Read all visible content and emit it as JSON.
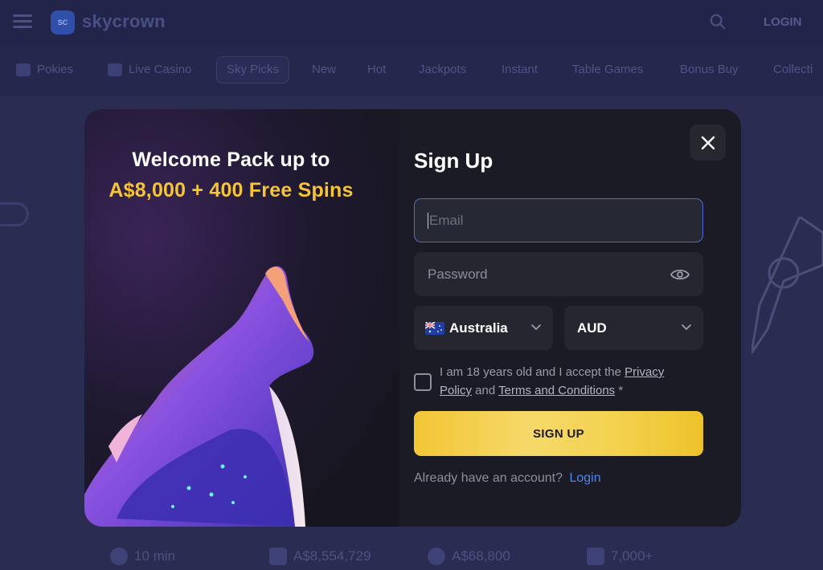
{
  "header": {
    "logo_mark": "SC",
    "logo_text": "skycrown",
    "login_label": "LOGIN"
  },
  "categories": [
    {
      "label": "Pokies",
      "icon": "slot-machine-icon"
    },
    {
      "label": "Live Casino",
      "icon": "play-icon"
    },
    {
      "label": "Sky Picks",
      "active": true
    },
    {
      "label": "New"
    },
    {
      "label": "Hot"
    },
    {
      "label": "Jackpots"
    },
    {
      "label": "Instant"
    },
    {
      "label": "Table Games"
    },
    {
      "label": "Bonus Buy"
    },
    {
      "label": "Collecti"
    }
  ],
  "stats": [
    {
      "icon": "clock-icon",
      "value": "10 min"
    },
    {
      "icon": "wallet-icon",
      "value": "A$8,554,729"
    },
    {
      "icon": "lightning-icon",
      "value": "A$68,800"
    },
    {
      "icon": "games-icon",
      "value": "7,000+"
    }
  ],
  "modal": {
    "promo_title": "Welcome Pack up to",
    "promo_amount": "A$8,000 + 400 Free Spins",
    "form_title": "Sign Up",
    "email_placeholder": "Email",
    "password_placeholder": "Password",
    "country_value": "Australia",
    "currency_value": "AUD",
    "consent_prefix": "I am 18 years old and I accept the ",
    "privacy_link": "Privacy Policy",
    "consent_and": " and ",
    "terms_link": "Terms and Conditions",
    "consent_suffix": " *",
    "signup_label": "SIGN UP",
    "have_account": "Already have an account?",
    "login_link": "Login"
  },
  "colors": {
    "accent_yellow": "#f6c437",
    "link_blue": "#4c86f0",
    "modal_bg": "#1b1b25"
  }
}
